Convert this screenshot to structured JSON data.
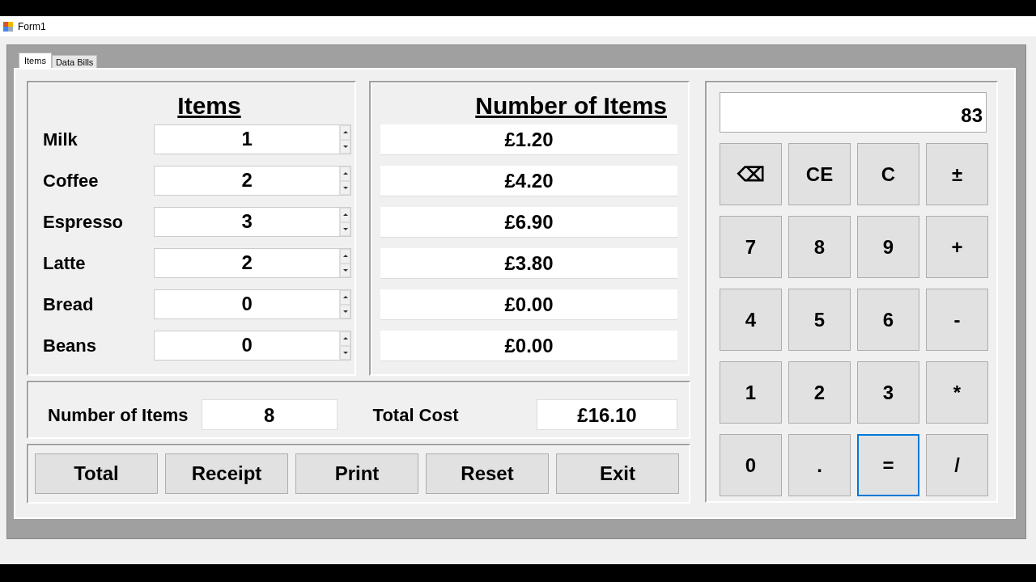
{
  "window": {
    "title": "Form1"
  },
  "tabs": [
    {
      "label": "Items",
      "selected": true
    },
    {
      "label": "Data Bills",
      "selected": false
    }
  ],
  "items_panel": {
    "heading": "Items",
    "rows": [
      {
        "label": "Milk",
        "quantity": "1"
      },
      {
        "label": "Coffee",
        "quantity": "2"
      },
      {
        "label": "Espresso",
        "quantity": "3"
      },
      {
        "label": "Latte",
        "quantity": "2"
      },
      {
        "label": "Bread",
        "quantity": "0"
      },
      {
        "label": "Beans",
        "quantity": "0"
      }
    ]
  },
  "cost_panel": {
    "heading": "Number of Items",
    "costs": [
      "£1.20",
      "£4.20",
      "£6.90",
      "£3.80",
      "£0.00",
      "£0.00"
    ]
  },
  "totals": {
    "items_label": "Number of Items",
    "items_value": "8",
    "cost_label": "Total Cost",
    "cost_value": "£16.10"
  },
  "buttons": [
    "Total",
    "Receipt",
    "Print",
    "Reset",
    "Exit"
  ],
  "calculator": {
    "display": "83",
    "keys": [
      {
        "label": "⌫",
        "focused": false
      },
      {
        "label": "CE",
        "focused": false
      },
      {
        "label": "C",
        "focused": false
      },
      {
        "label": "±",
        "focused": false
      },
      {
        "label": "7",
        "focused": false
      },
      {
        "label": "8",
        "focused": false
      },
      {
        "label": "9",
        "focused": false
      },
      {
        "label": "+",
        "focused": false
      },
      {
        "label": "4",
        "focused": false
      },
      {
        "label": "5",
        "focused": false
      },
      {
        "label": "6",
        "focused": false
      },
      {
        "label": "-",
        "focused": false
      },
      {
        "label": "1",
        "focused": false
      },
      {
        "label": "2",
        "focused": false
      },
      {
        "label": "3",
        "focused": false
      },
      {
        "label": "*",
        "focused": false
      },
      {
        "label": "0",
        "focused": false
      },
      {
        "label": ".",
        "focused": false
      },
      {
        "label": "=",
        "focused": true
      },
      {
        "label": "/",
        "focused": false
      }
    ]
  }
}
